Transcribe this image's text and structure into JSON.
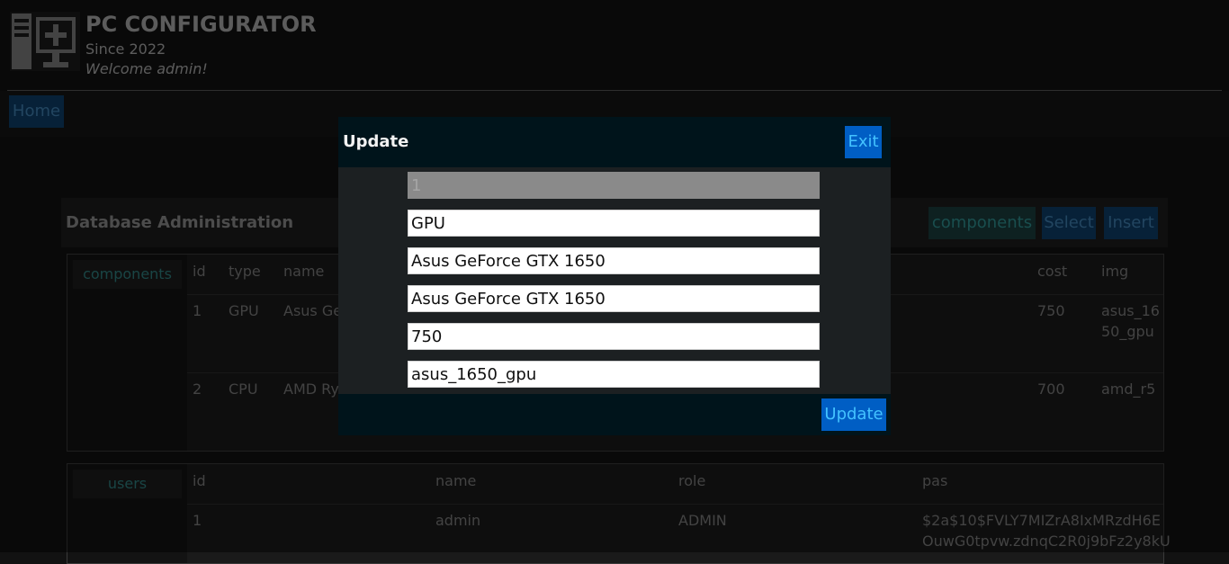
{
  "header": {
    "title": "PC CONFIGURATOR",
    "since": "Since 2022",
    "welcome": "Welcome admin!"
  },
  "nav": {
    "home": "Home"
  },
  "admin": {
    "title": "Database Administration",
    "buttons": {
      "components": "components",
      "select": "Select",
      "insert": "Insert"
    }
  },
  "components_table": {
    "tag": "components",
    "headers": [
      "id",
      "type",
      "name",
      "cost",
      "img"
    ],
    "rows": [
      {
        "id": "1",
        "type": "GPU",
        "name": "Asus Ge",
        "cost": "750",
        "img_line1": "asus_16",
        "img_line2": "50_gpu"
      },
      {
        "id": "2",
        "type": "CPU",
        "name": "AMD Ry",
        "cost": "700",
        "img_line1": "amd_r5",
        "img_line2": ""
      }
    ]
  },
  "users_table": {
    "tag": "users",
    "headers": [
      "id",
      "name",
      "role",
      "pas"
    ],
    "rows": [
      {
        "id": "1",
        "name": "admin",
        "role": "ADMIN",
        "pas_line1": "$2a$10$FVLY7MIZrA8IxMRzdH6E",
        "pas_line2": "OuwG0tpvw.zdnqC2R0j9bFz2y8kU"
      }
    ]
  },
  "modal": {
    "title": "Update",
    "exit": "Exit",
    "submit": "Update",
    "fields": {
      "id": "1",
      "type": "GPU",
      "name": "Asus GeForce GTX 1650",
      "description": "Asus GeForce GTX 1650",
      "cost": "750",
      "img": "asus_1650_gpu"
    }
  },
  "colors": {
    "accent": "#005ec4",
    "accent_text": "#43c2ff",
    "modal_bg": "#00141b"
  }
}
